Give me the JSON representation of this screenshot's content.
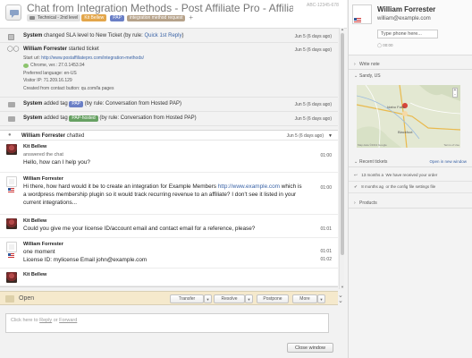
{
  "header": {
    "title": "Chat from Integration Methods  - Post Affiliate Pro - Affilia",
    "ticket_id": "ABC-12345-678",
    "department": "Technical - 2nd level",
    "agent": "Kit Bellew",
    "tags": [
      "PAP",
      "integration method request"
    ],
    "add_tag": "+"
  },
  "events": [
    {
      "who": "System",
      "text": "changed SLA level to New Ticket (by rule: ",
      "rule": "Quick 1st Reply",
      "close": ")",
      "time": "Jun 5 (6 days ago)"
    },
    {
      "who": "William Forrester",
      "text": "started ticket",
      "time": "Jun 5 (6 days ago)",
      "details": {
        "start_url_label": "Start url:",
        "start_url": "http://www.postaffiliatepro.com/integration-methods/",
        "browser": "Chrome, ver.: 27.0.1453.94",
        "language": "Preferred language: en-US",
        "ip": "Visitor IP: 71.209.16.129",
        "created": "Created from contact button: qu.com/la pages"
      }
    },
    {
      "who": "System",
      "text": "added tag",
      "tag": "PAP",
      "rule": "(by rule: Conversation from Hosted PAP)",
      "time": "Jun 5 (6 days ago)"
    },
    {
      "who": "System",
      "text": "added tag",
      "tag": "PAP-hosted",
      "rule": "(by rule: Conversation from Hosted PAP)",
      "time": "Jun 5 (6 days ago)"
    }
  ],
  "chat": {
    "who": "William Forrester",
    "action": "chatted",
    "time": "Jun 5 (6 days ago)",
    "messages": [
      {
        "name": "Kit Bellew",
        "sub": "answered the chat",
        "text": "Hello, how can I help you?",
        "time": "01:00"
      },
      {
        "name": "William Forrester",
        "text_a": "Hi there, how hard would it be to create an integration for Example Members ",
        "link": "http://www.example.com",
        "text_b": " which is a wordpress membership plugin so it would track recurring revenue to an affiliate? I don't see it listed in your current integrations...",
        "time": "01:00"
      },
      {
        "name": "Kit Bellew",
        "text": "Could you give me your license ID/account email and contact email for a reference, please?",
        "time": "01:01"
      },
      {
        "name": "William Forrester",
        "line1": "one moment",
        "line2": "License ID: mylicense Email john@example.com",
        "time1": "01:01",
        "time2": "01:02"
      },
      {
        "name": "Kit Bellew"
      }
    ]
  },
  "actions": {
    "status": "Open",
    "transfer": "Transfer",
    "resolve": "Resolve",
    "postpone": "Postpone",
    "more": "More"
  },
  "reply": {
    "prefix": "Click here to ",
    "reply_link": "Reply",
    "or": " or ",
    "forward_link": "Forward"
  },
  "close_window": "Close window",
  "customer": {
    "name": "William Forrester",
    "email": "william@example.com",
    "phone_placeholder": "Type phone here...",
    "local_time": "00:00"
  },
  "panel": {
    "write_note": "Write note",
    "location": "Sandy, US",
    "map_labels": [
      "Idaho Falls",
      "Blackfoot"
    ],
    "map_attr": "Map data ©2013 Google",
    "map_terms": "Terms of Use",
    "recent_tickets": "Recent tickets",
    "open_new_window": "Open in new window",
    "tickets": [
      {
        "age": "13 months a",
        "text": "We have received your order"
      },
      {
        "age": "8 months ag",
        "text": "or the config file settings file"
      }
    ],
    "products": "Products"
  }
}
